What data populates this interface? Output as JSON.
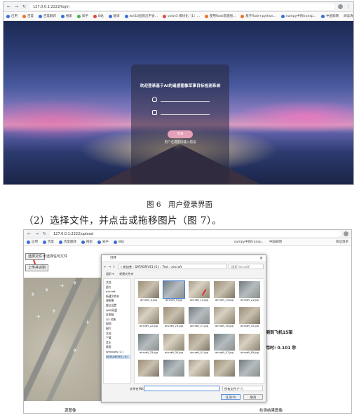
{
  "figure6": {
    "url": "127.0.0.1:2222/login",
    "bookmarks": [
      "应用",
      "百度",
      "百度翻译",
      "搜索",
      "知乎",
      "B站",
      "翻译",
      "win10固装出不会...",
      "yolov5 模块化（1）...",
      "使用flask搭建图...",
      "基于flask+python...",
      "numpy中的transp...",
      "中国知网"
    ],
    "bookmarks_right": "阅读清单",
    "login": {
      "title": "欢迎登录基于AI的遥感图像军事目标检测系统",
      "button": "登录",
      "hint": "用户名或密码输入错误"
    },
    "caption": "图 6　用户登录界面"
  },
  "paragraph": "（2）选择文件，并点击或拖移图片（图 7）。",
  "figure7": {
    "url": "127.0.0.1:2222/upload",
    "bookmarks": [
      "应用",
      "百度",
      "百度翻译",
      "搜索",
      "知乎",
      "B站"
    ],
    "bookmarks_right": "阅读清单",
    "bookmark_mid": "numpy中的transp...",
    "bookmark_mid2": "中国知网",
    "choose_button": "选择文件",
    "no_file": "未选择任何文件",
    "upload_button": "上传并识别",
    "result_count": "测到飞机15架",
    "result_time": "用时: 0.101 秒",
    "label_source": "源图像",
    "label_detect": "检测结果图像",
    "dialog": {
      "title": "打开",
      "path": "« 新加卷 › DATADRIVE1 (E:) › Test › aircraft",
      "search_placeholder": "搜索\"aircraft\"",
      "toolbar": "组织 ▾　　新建文件夹",
      "sidebar": [
        "文档",
        "图片",
        "aircraft",
        "新建文件夹",
        "源图像",
        "雷达设置",
        "WPS网盘",
        "此电脑",
        "3D 对象",
        "视频",
        "图片",
        "文档",
        "下载",
        "音乐",
        "桌面",
        "Windows (C:)",
        "DATADRIVE1 (E:)"
      ],
      "files": [
        "aircraft_4.jpg",
        "aircraft_9.jpg",
        "aircraft_14.jpg",
        "aircraft_19.jpg",
        "aircraft_21.jpg",
        "aircraft_22.jpg",
        "aircraft_23.jpg",
        "aircraft_27.jpg",
        "aircraft_30.jpg",
        "aircraft_32.jpg",
        "aircraft_33.jpg",
        "aircraft_34.jpg",
        "aircraft_41.jpg",
        "aircraft_57.jpg",
        "aircraft_59.jpg",
        "",
        "",
        "",
        "",
        ""
      ],
      "filename_label": "文件名(N):",
      "filetype": "所有文件 (*.*)",
      "open_button": "打开(O)",
      "cancel_button": "取消"
    }
  }
}
